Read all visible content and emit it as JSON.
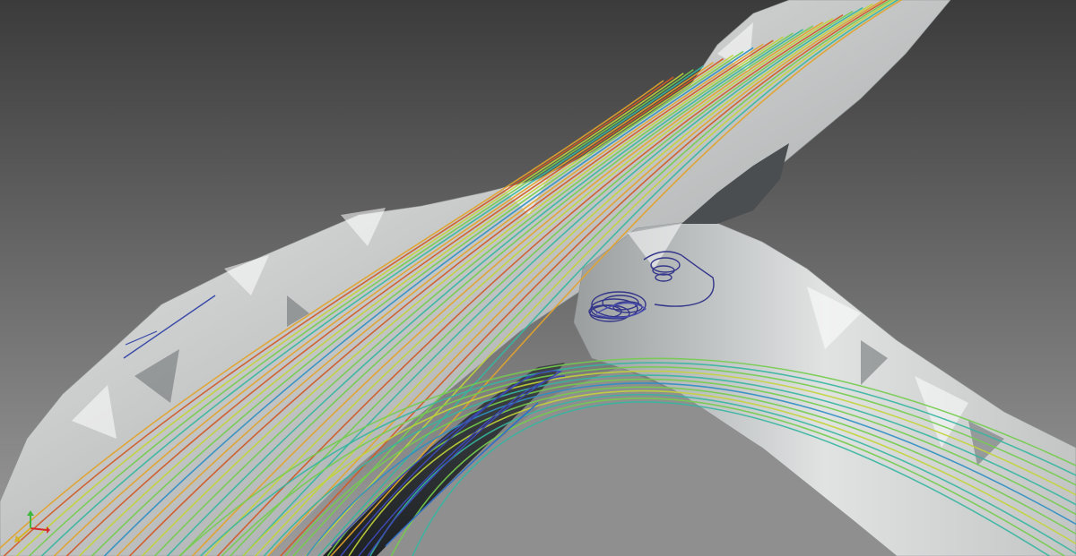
{
  "scene": {
    "background_top": "#3a3a3a",
    "background_bottom": "#9a9a9a",
    "terrain_light": "#e6e7e7",
    "terrain_mid": "#b9bbbb",
    "terrain_dark": "#5d6163",
    "streamline_palette": [
      "#2a2f86",
      "#3c55b8",
      "#2f8fc2",
      "#35b6a0",
      "#74cc4e",
      "#c2d43a",
      "#e2a32b",
      "#cf5a26"
    ],
    "vortex_color": "#34368a"
  },
  "axes": {
    "x_color": "#d62b2b",
    "y_color": "#3db83d",
    "z_color": "#d6b22b"
  }
}
